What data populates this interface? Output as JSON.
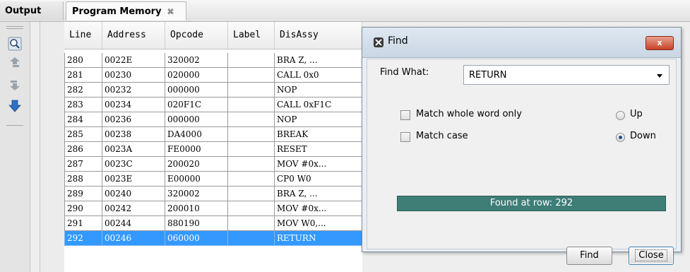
{
  "tabs": {
    "output": "Output",
    "program_memory": "Program Memory",
    "program_memory_close": "⌘"
  },
  "toolbar": {
    "icons": [
      "find-icon",
      "move-up-icon",
      "move-down-icon",
      "go-to-icon"
    ]
  },
  "table": {
    "columns": [
      "Line",
      "Address",
      "Opcode",
      "Label",
      "DisAssy"
    ],
    "rows": [
      [
        "280",
        "0022E",
        "320002",
        "",
        "BRA Z, ..."
      ],
      [
        "281",
        "00230",
        "020000",
        "",
        "CALL 0x0"
      ],
      [
        "282",
        "00232",
        "000000",
        "",
        "NOP"
      ],
      [
        "283",
        "00234",
        "020F1C",
        "",
        "CALL 0xF1C"
      ],
      [
        "284",
        "00236",
        "000000",
        "",
        "NOP"
      ],
      [
        "285",
        "00238",
        "DA4000",
        "",
        "BREAK"
      ],
      [
        "286",
        "0023A",
        "FE0000",
        "",
        "RESET"
      ],
      [
        "287",
        "0023C",
        "200020",
        "",
        "MOV #0x..."
      ],
      [
        "288",
        "0023E",
        "E00000",
        "",
        "CP0 W0"
      ],
      [
        "289",
        "00240",
        "320002",
        "",
        "BRA Z, ..."
      ],
      [
        "290",
        "00242",
        "200010",
        "",
        "MOV #0x..."
      ],
      [
        "291",
        "00244",
        "880190",
        "",
        "MOV W0,..."
      ],
      [
        "292",
        "00246",
        "060000",
        "",
        "RETURN"
      ]
    ],
    "selected_row": 12
  },
  "find_dialog": {
    "title": "Find",
    "close_label": "x",
    "find_what_label": "Find What:",
    "find_what_value": "RETURN",
    "match_whole_word_label": "Match whole word only",
    "match_whole_word_checked": false,
    "match_case_label": "Match case",
    "match_case_checked": false,
    "direction_up_label": "Up",
    "direction_down_label": "Down",
    "direction_selected": "Down",
    "status_text": "Found at row: 292",
    "find_button": "Find",
    "close_button": "Close"
  },
  "colors": {
    "selection": "#3399ff",
    "status_bar": "#3f7d77",
    "close_button_red": "#c8432a"
  }
}
